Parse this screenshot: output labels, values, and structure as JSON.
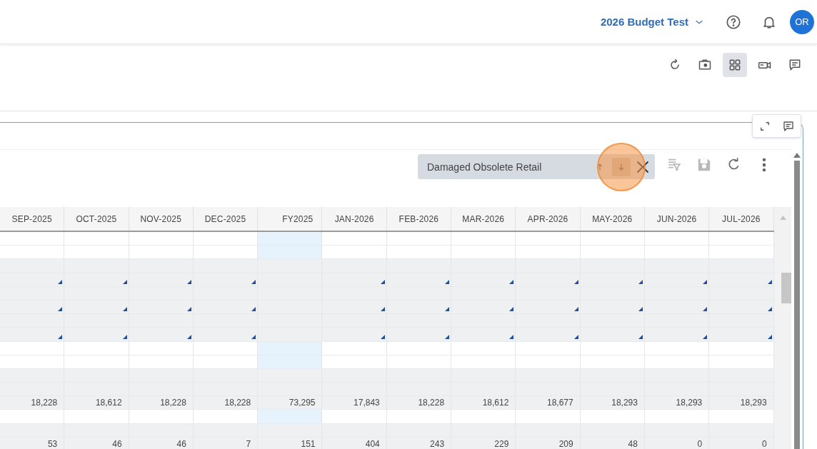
{
  "header": {
    "project": "2026 Budget Test",
    "avatar": "OR"
  },
  "toolbar": [
    {
      "kind": "refresh",
      "selected": false
    },
    {
      "kind": "camera",
      "selected": false
    },
    {
      "kind": "grid",
      "selected": true
    },
    {
      "kind": "video",
      "selected": false
    },
    {
      "kind": "comment",
      "selected": false
    }
  ],
  "panel_tools": [
    {
      "kind": "expand"
    },
    {
      "kind": "comment"
    }
  ],
  "search": {
    "value": "Damaged Obsolete Retail",
    "buttons": [
      {
        "kind": "up",
        "selected": false,
        "highlighted": false
      },
      {
        "kind": "down",
        "selected": true,
        "highlighted": true
      },
      {
        "kind": "close",
        "selected": false,
        "highlighted": false
      }
    ]
  },
  "actions": [
    {
      "kind": "filter",
      "disabled": true
    },
    {
      "kind": "save",
      "disabled": true
    },
    {
      "kind": "redo",
      "disabled": false
    },
    {
      "kind": "more",
      "disabled": false
    }
  ],
  "table": {
    "columns": [
      {
        "label": "SEP-2025",
        "kind": "month"
      },
      {
        "label": "OCT-2025",
        "kind": "month"
      },
      {
        "label": "NOV-2025",
        "kind": "month"
      },
      {
        "label": "DEC-2025",
        "kind": "month"
      },
      {
        "label": "FY2025",
        "kind": "total"
      },
      {
        "label": "JAN-2026",
        "kind": "month"
      },
      {
        "label": "FEB-2026",
        "kind": "month"
      },
      {
        "label": "MAR-2026",
        "kind": "month"
      },
      {
        "label": "APR-2026",
        "kind": "month"
      },
      {
        "label": "MAY-2026",
        "kind": "month"
      },
      {
        "label": "JUN-2026",
        "kind": "month"
      },
      {
        "label": "JUL-2026",
        "kind": "month"
      }
    ],
    "rows": [
      {
        "kind": "input",
        "flagged": false
      },
      {
        "kind": "input",
        "flagged": false
      },
      {
        "kind": "calc",
        "flagged": false
      },
      {
        "kind": "calc",
        "flagged": true
      },
      {
        "kind": "calc",
        "flagged": false
      },
      {
        "kind": "calc",
        "flagged": true
      },
      {
        "kind": "calc",
        "flagged": false
      },
      {
        "kind": "calc",
        "flagged": true
      },
      {
        "kind": "input",
        "flagged": false
      },
      {
        "kind": "input",
        "flagged": false
      },
      {
        "kind": "calc",
        "flagged": false
      },
      {
        "kind": "calc",
        "flagged": false
      },
      {
        "kind": "calc",
        "flagged": false,
        "values": [
          "18,228",
          "18,612",
          "18,228",
          "18,228",
          "73,295",
          "17,843",
          "18,228",
          "18,612",
          "18,677",
          "18,293",
          "18,293",
          "18,293"
        ]
      },
      {
        "kind": "input",
        "flagged": false
      },
      {
        "kind": "calc",
        "flagged": false
      },
      {
        "kind": "calc",
        "flagged": false,
        "values": [
          "53",
          "46",
          "46",
          "7",
          "151",
          "404",
          "243",
          "229",
          "209",
          "48",
          "0",
          "0"
        ]
      }
    ]
  }
}
